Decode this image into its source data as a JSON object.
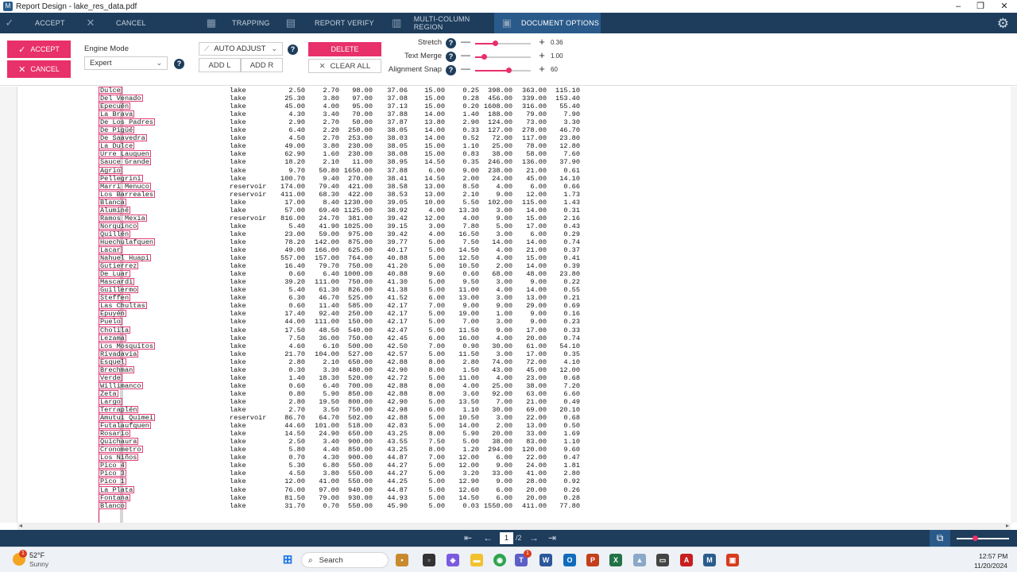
{
  "window": {
    "title": "Report Design - lake_res_data.pdf",
    "app_icon": "M"
  },
  "ribbon": {
    "tabs": [
      {
        "label": "ACCEPT",
        "icon": "check-icon"
      },
      {
        "label": "CANCEL",
        "icon": "close-icon"
      },
      {
        "label": "TRAPPING",
        "icon": "trapping-icon"
      },
      {
        "label": "REPORT VERIFY",
        "icon": "report-verify-icon"
      },
      {
        "label": "MULTI-COLUMN REGION",
        "icon": "multi-column-icon"
      },
      {
        "label": "DOCUMENT OPTIONS",
        "icon": "document-options-icon"
      }
    ],
    "active_tab": "DOCUMENT OPTIONS"
  },
  "toolbar": {
    "accept_label": "ACCEPT",
    "cancel_label": "CANCEL",
    "engine_mode_label": "Engine Mode",
    "engine_mode_value": "Expert",
    "auto_adjust_label": "AUTO ADJUST",
    "add_l_label": "ADD L",
    "add_r_label": "ADD R",
    "delete_label": "DELETE",
    "clear_all_label": "CLEAR ALL",
    "sliders": [
      {
        "label": "Stretch",
        "value": "0.36",
        "fraction": 0.36
      },
      {
        "label": "Text Merge",
        "value": "1.00",
        "fraction": 0.16
      },
      {
        "label": "Alignment Snap",
        "value": "60",
        "fraction": 0.6
      }
    ],
    "accent_color": "#e8306a"
  },
  "table": {
    "rows": [
      [
        "Dulce",
        "lake",
        "2.50",
        "2.70",
        "98.00",
        "37.06",
        "15.00",
        "0.25",
        "398.00",
        "363.00",
        "115.10"
      ],
      [
        "Del Venado",
        "lake",
        "25.30",
        "3.80",
        "97.00",
        "37.08",
        "15.00",
        "0.28",
        "456.00",
        "339.00",
        "153.40"
      ],
      [
        "Epecuén",
        "lake",
        "45.00",
        "4.00",
        "95.00",
        "37.13",
        "15.00",
        "0.20",
        "1608.00",
        "316.00",
        "55.40"
      ],
      [
        "La Brava",
        "lake",
        "4.30",
        "3.40",
        "70.00",
        "37.88",
        "14.00",
        "1.40",
        "188.00",
        "79.00",
        "7.90"
      ],
      [
        "De Los Padres",
        "lake",
        "2.90",
        "2.70",
        "50.00",
        "37.87",
        "13.80",
        "2.90",
        "124.00",
        "73.00",
        "3.30"
      ],
      [
        "De Pigüé",
        "lake",
        "6.40",
        "2.20",
        "250.00",
        "38.05",
        "14.00",
        "0.33",
        "127.00",
        "278.00",
        "46.70"
      ],
      [
        "De Saavedra",
        "lake",
        "4.50",
        "2.70",
        "253.00",
        "38.03",
        "14.00",
        "0.52",
        "72.00",
        "117.00",
        "23.80"
      ],
      [
        "La Dulce",
        "lake",
        "49.00",
        "3.80",
        "230.00",
        "38.05",
        "15.00",
        "1.10",
        "25.00",
        "78.00",
        "12.80"
      ],
      [
        "Urre Lauquen",
        "lake",
        "62.90",
        "1.60",
        "230.00",
        "38.08",
        "15.00",
        "0.83",
        "38.00",
        "58.00",
        "7.60"
      ],
      [
        "Sauce Grande",
        "lake",
        "18.20",
        "2.10",
        "11.00",
        "38.95",
        "14.50",
        "0.35",
        "246.00",
        "136.00",
        "37.90"
      ],
      [
        "Agrio",
        "lake",
        "9.70",
        "50.80",
        "1650.00",
        "37.88",
        "6.00",
        "9.00",
        "238.00",
        "21.00",
        "0.61"
      ],
      [
        "Pellegrini",
        "lake",
        "100.70",
        "9.40",
        "270.00",
        "38.41",
        "14.50",
        "2.00",
        "24.00",
        "45.00",
        "14.10"
      ],
      [
        "Marri Menuco",
        "reservoir",
        "174.00",
        "79.40",
        "421.00",
        "38.58",
        "13.00",
        "8.50",
        "4.00",
        "6.00",
        "0.66"
      ],
      [
        "Los Barreales",
        "reservoir",
        "411.00",
        "68.30",
        "422.00",
        "38.53",
        "13.00",
        "2.10",
        "9.00",
        "12.00",
        "1.73"
      ],
      [
        "Blanca",
        "lake",
        "17.00",
        "8.40",
        "1230.00",
        "39.05",
        "10.00",
        "5.50",
        "102.00",
        "115.00",
        "1.43"
      ],
      [
        "Aluminé",
        "lake",
        "57.00",
        "69.40",
        "1125.00",
        "38.92",
        "4.00",
        "13.30",
        "3.00",
        "14.00",
        "0.31"
      ],
      [
        "Ramos Mexia",
        "reservoir",
        "816.00",
        "24.70",
        "381.00",
        "39.42",
        "12.00",
        "4.00",
        "9.00",
        "15.00",
        "2.16"
      ],
      [
        "Norquinco",
        "lake",
        "5.40",
        "41.90",
        "1025.00",
        "39.15",
        "3.00",
        "7.80",
        "5.00",
        "17.00",
        "0.43"
      ],
      [
        "Quillén",
        "lake",
        "23.00",
        "59.00",
        "975.00",
        "39.42",
        "4.00",
        "16.50",
        "3.00",
        "6.00",
        "0.29"
      ],
      [
        "Huechulafquen",
        "lake",
        "78.20",
        "142.00",
        "875.00",
        "39.77",
        "5.00",
        "7.50",
        "14.00",
        "14.00",
        "0.74"
      ],
      [
        "Lacar",
        "lake",
        "49.00",
        "166.00",
        "625.00",
        "40.17",
        "5.00",
        "14.50",
        "4.00",
        "21.00",
        "0.37"
      ],
      [
        "Nahuel Huapi",
        "lake",
        "557.00",
        "157.00",
        "764.00",
        "40.88",
        "5.00",
        "12.50",
        "4.00",
        "15.00",
        "0.41"
      ],
      [
        "Gutierrez",
        "lake",
        "16.40",
        "79.70",
        "750.00",
        "41.20",
        "5.00",
        "10.50",
        "2.00",
        "14.00",
        "0.39"
      ],
      [
        "De Luar",
        "lake",
        "0.60",
        "6.40",
        "1000.00",
        "40.88",
        "9.60",
        "0.60",
        "68.00",
        "48.00",
        "23.80"
      ],
      [
        "Mascardi",
        "lake",
        "39.20",
        "111.00",
        "750.00",
        "41.30",
        "5.00",
        "9.50",
        "3.00",
        "9.00",
        "0.22"
      ],
      [
        "Guillermo",
        "lake",
        "5.40",
        "61.30",
        "826.00",
        "41.38",
        "5.00",
        "11.00",
        "4.00",
        "14.00",
        "0.55"
      ],
      [
        "Steffen",
        "lake",
        "6.30",
        "46.70",
        "525.00",
        "41.52",
        "6.00",
        "13.00",
        "3.00",
        "13.00",
        "0.21"
      ],
      [
        "Las Chultas",
        "lake",
        "0.60",
        "11.40",
        "585.00",
        "42.17",
        "7.00",
        "9.00",
        "9.00",
        "29.00",
        "0.69"
      ],
      [
        "Epuyén",
        "lake",
        "17.40",
        "92.40",
        "250.00",
        "42.17",
        "5.00",
        "19.00",
        "1.00",
        "9.00",
        "0.16"
      ],
      [
        "Puelo",
        "lake",
        "44.00",
        "111.00",
        "150.00",
        "42.17",
        "5.00",
        "7.00",
        "3.00",
        "9.00",
        "0.23"
      ],
      [
        "Cholila",
        "lake",
        "17.50",
        "48.50",
        "540.00",
        "42.47",
        "5.00",
        "11.50",
        "9.00",
        "17.00",
        "0.33"
      ],
      [
        "Lezama",
        "lake",
        "7.50",
        "36.00",
        "750.00",
        "42.45",
        "6.00",
        "16.00",
        "4.00",
        "20.00",
        "0.74"
      ],
      [
        "Los Mosquitos",
        "lake",
        "4.60",
        "6.10",
        "500.00",
        "42.50",
        "7.00",
        "0.90",
        "30.00",
        "61.00",
        "54.10"
      ],
      [
        "Rivadavia",
        "lake",
        "21.70",
        "104.00",
        "527.00",
        "42.57",
        "5.00",
        "11.50",
        "3.00",
        "17.00",
        "0.35"
      ],
      [
        "Esquel",
        "lake",
        "2.80",
        "2.10",
        "650.00",
        "42.88",
        "8.00",
        "2.80",
        "74.00",
        "72.00",
        "4.10"
      ],
      [
        "Brechman",
        "lake",
        "0.30",
        "3.30",
        "480.00",
        "42.90",
        "8.00",
        "1.50",
        "43.00",
        "45.00",
        "12.00"
      ],
      [
        "Verde",
        "lake",
        "1.40",
        "18.30",
        "520.00",
        "42.72",
        "5.00",
        "11.00",
        "4.00",
        "23.00",
        "0.68"
      ],
      [
        "Willimanco",
        "lake",
        "0.60",
        "6.40",
        "700.00",
        "42.88",
        "8.00",
        "4.00",
        "25.00",
        "38.00",
        "7.20"
      ],
      [
        "Zeta",
        "lake",
        "0.80",
        "5.90",
        "850.00",
        "42.88",
        "8.00",
        "3.60",
        "92.00",
        "63.00",
        "6.60"
      ],
      [
        "Largo",
        "lake",
        "2.80",
        "19.50",
        "800.00",
        "42.90",
        "5.00",
        "13.50",
        "7.00",
        "21.00",
        "0.49"
      ],
      [
        "Terraplén",
        "lake",
        "2.70",
        "3.50",
        "750.00",
        "42.98",
        "6.00",
        "1.10",
        "30.00",
        "69.00",
        "20.10"
      ],
      [
        "Amutui Quimei",
        "reservoir",
        "86.70",
        "64.70",
        "502.00",
        "42.88",
        "5.00",
        "10.50",
        "3.00",
        "22.00",
        "0.68"
      ],
      [
        "Futalaufquen",
        "lake",
        "44.60",
        "101.00",
        "518.00",
        "42.83",
        "5.00",
        "14.00",
        "2.00",
        "13.00",
        "0.50"
      ],
      [
        "Rosario",
        "lake",
        "14.50",
        "24.90",
        "650.00",
        "43.25",
        "8.00",
        "5.90",
        "20.00",
        "33.00",
        "1.69"
      ],
      [
        "Quichaura",
        "lake",
        "2.50",
        "3.40",
        "900.00",
        "43.55",
        "7.50",
        "5.00",
        "38.00",
        "83.00",
        "1.10"
      ],
      [
        "Cronometro",
        "lake",
        "5.80",
        "4.40",
        "850.00",
        "43.25",
        "8.00",
        "1.20",
        "294.00",
        "120.00",
        "9.60"
      ],
      [
        "Los Niños",
        "lake",
        "0.70",
        "4.30",
        "900.00",
        "44.87",
        "7.00",
        "12.00",
        "6.00",
        "22.00",
        "0.47"
      ],
      [
        "Pico 4",
        "lake",
        "5.30",
        "6.80",
        "550.00",
        "44.27",
        "5.00",
        "12.00",
        "9.00",
        "24.00",
        "1.81"
      ],
      [
        "Pico 3",
        "lake",
        "4.50",
        "3.80",
        "550.00",
        "44.27",
        "5.00",
        "3.20",
        "33.00",
        "41.00",
        "2.80"
      ],
      [
        "Pico 1",
        "lake",
        "12.00",
        "41.00",
        "550.00",
        "44.25",
        "5.00",
        "12.90",
        "9.00",
        "28.00",
        "0.92"
      ],
      [
        "La Plata",
        "lake",
        "76.00",
        "97.00",
        "940.00",
        "44.87",
        "5.00",
        "12.60",
        "6.00",
        "20.00",
        "0.26"
      ],
      [
        "Fontana",
        "lake",
        "81.50",
        "79.00",
        "930.00",
        "44.93",
        "5.00",
        "14.50",
        "6.00",
        "20.00",
        "0.28"
      ],
      [
        "Blanco",
        "lake",
        "31.70",
        "0.70",
        "550.00",
        "45.90",
        "5.00",
        "0.03",
        "1550.00",
        "411.00",
        "77.80"
      ]
    ]
  },
  "statusbar": {
    "page_current": "1",
    "page_total": "/2"
  },
  "taskbar": {
    "weather_temp": "52°F",
    "weather_desc": "Sunny",
    "weather_badge": "1",
    "search_placeholder": "Search",
    "teams_badge": "1",
    "time": "12:57 PM",
    "date": "11/20/2024"
  }
}
